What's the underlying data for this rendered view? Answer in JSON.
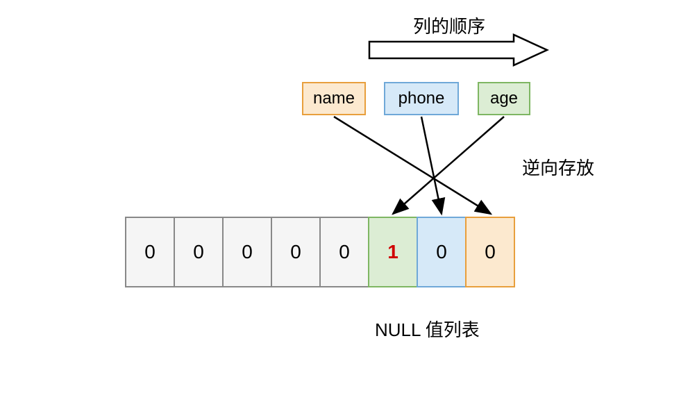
{
  "labels": {
    "column_order": "列的顺序",
    "reverse_storage": "逆向存放",
    "null_list": "NULL 值列表"
  },
  "columns": {
    "name": "name",
    "phone": "phone",
    "age": "age"
  },
  "bits": {
    "b0": "0",
    "b1": "0",
    "b2": "0",
    "b3": "0",
    "b4": "0",
    "b5": "1",
    "b6": "0",
    "b7": "0"
  }
}
